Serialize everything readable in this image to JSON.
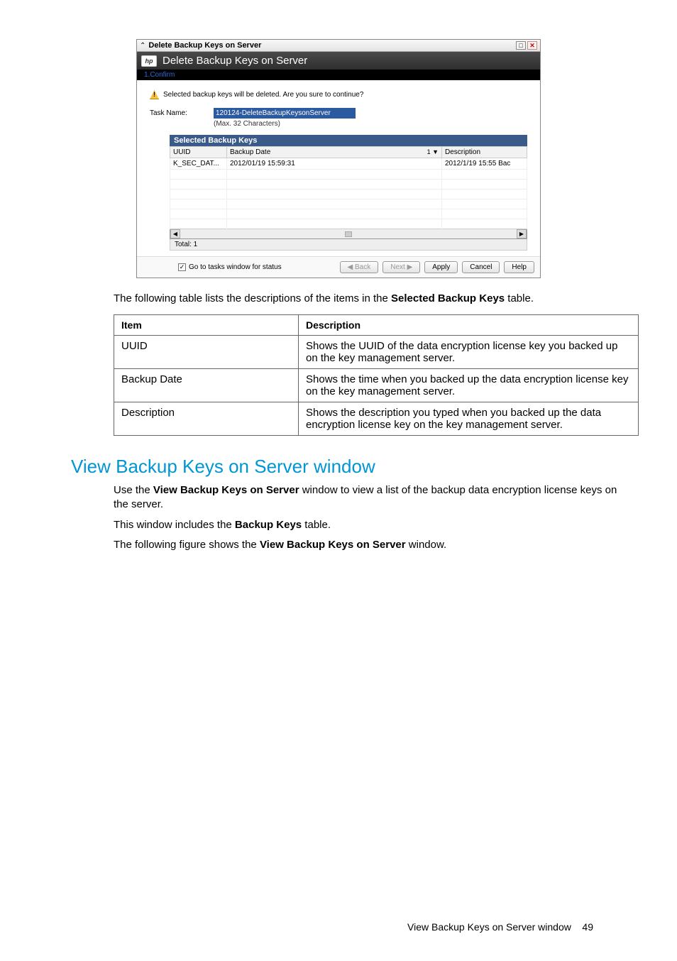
{
  "dialog": {
    "titlebar": "Delete Backup Keys on Server",
    "header": "Delete Backup Keys on Server",
    "step": "1.Confirm",
    "warning": "Selected backup keys will be deleted. Are you sure to continue?",
    "task_label": "Task Name:",
    "task_value": "120124-DeleteBackupKeysonServer",
    "task_hint": "(Max. 32 Characters)",
    "sbk_title": "Selected Backup Keys",
    "columns": {
      "uuid": "UUID",
      "backup_date": "Backup Date",
      "sort": "1 ▼",
      "description": "Description"
    },
    "row": {
      "uuid": "K_SEC_DAT...",
      "backup_date": "2012/01/19 15:59:31",
      "description": "2012/1/19 15:55 Bac"
    },
    "total": "Total:  1",
    "checkbox": "Go to tasks window for status",
    "buttons": {
      "back": "◀ Back",
      "next": "Next ▶",
      "apply": "Apply",
      "cancel": "Cancel",
      "help": "Help"
    }
  },
  "intro_text_before": "The following table lists the descriptions of the items in the ",
  "intro_bold": "Selected Backup Keys",
  "intro_text_after": " table.",
  "table": {
    "h_item": "Item",
    "h_desc": "Description",
    "rows": [
      {
        "item": "UUID",
        "desc": "Shows the UUID of the data encryption license key you backed up on the key management server."
      },
      {
        "item": "Backup Date",
        "desc": "Shows the time when you backed up the data encryption license key on the key management server."
      },
      {
        "item": "Description",
        "desc": "Shows the description you typed when you backed up the data encryption license key on the key management server."
      }
    ]
  },
  "section_heading": "View Backup Keys on Server window",
  "p1_before": "Use the ",
  "p1_bold": "View Backup Keys on Server",
  "p1_after": " window to view a list of the backup data encryption license keys on the server.",
  "p2_before": "This window includes the ",
  "p2_bold": "Backup Keys",
  "p2_after": " table.",
  "p3_before": "The following figure shows the ",
  "p3_bold": "View Backup Keys on Server",
  "p3_after": " window.",
  "footer_text": "View Backup Keys on Server window",
  "footer_page": "49"
}
